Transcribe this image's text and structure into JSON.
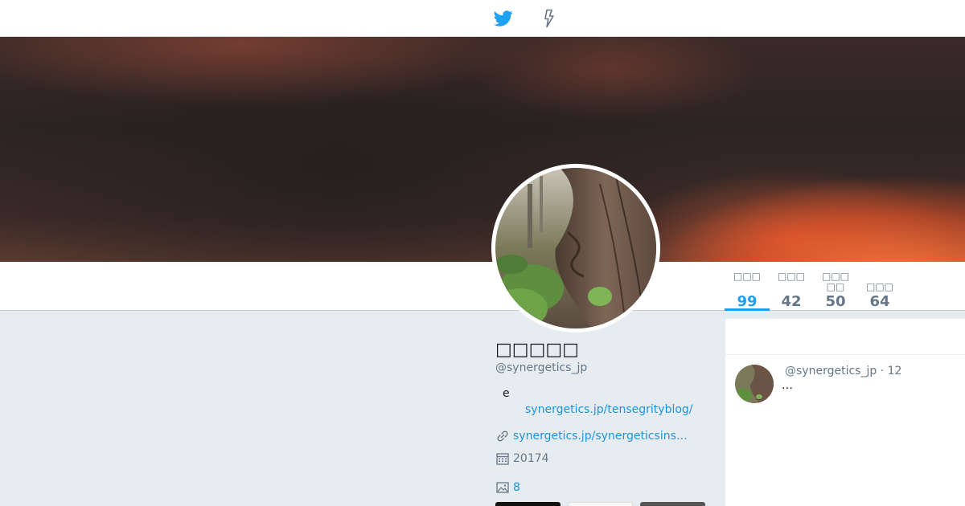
{
  "header": {
    "logo_icon": "twitter-bird-icon",
    "moments_icon": "lightning-icon",
    "accent_color": "#1da1f2"
  },
  "banner": {
    "description_icon": "sunset-sky-image"
  },
  "profile": {
    "name": "□□□□□",
    "handle": "@synergetics_jp",
    "bio": "e",
    "bio_link": "synergetics.jp/tensegrityblog/",
    "website": "synergetics.jp/synergeticsins…",
    "joined": "20174",
    "photos_count": "8"
  },
  "stats": [
    {
      "label": "□□□",
      "value": "99",
      "active": true
    },
    {
      "label": "□□□",
      "value": "42",
      "active": false
    },
    {
      "label": "□□□□□",
      "value": "50",
      "active": false
    },
    {
      "label": "□□□",
      "value": "64",
      "active": false
    }
  ],
  "sidebar": {
    "tweet": {
      "handle": "@synergetics_jp",
      "time": "12",
      "separator": "·",
      "text": "…"
    }
  }
}
